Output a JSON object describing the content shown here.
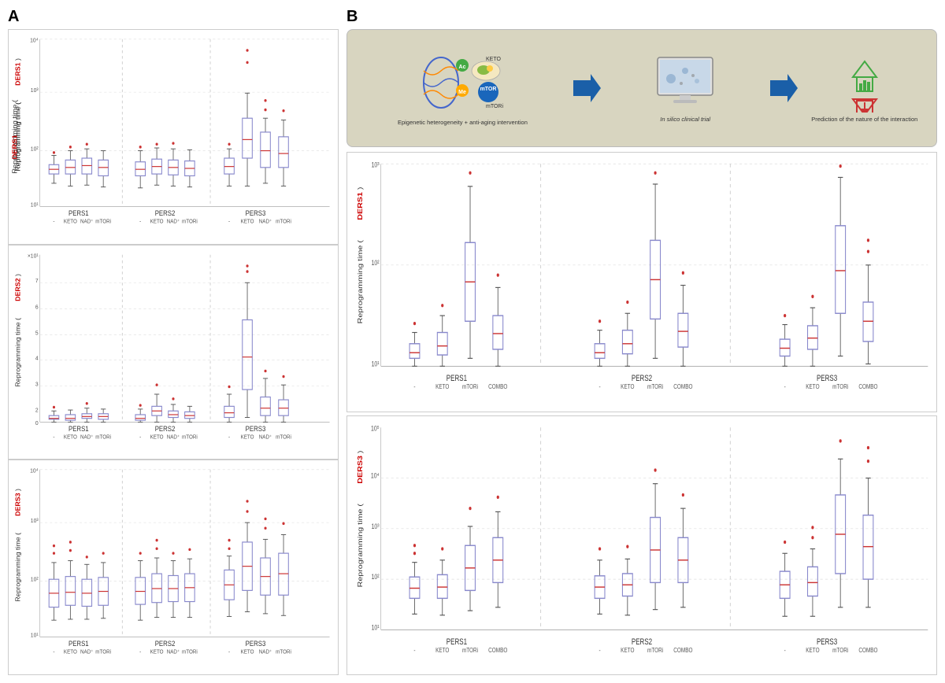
{
  "panelA": {
    "label": "A",
    "charts": [
      {
        "yLabel": "Reprogramming time (DERS1)",
        "yLabelColor": "#cc0000",
        "yScale": "log",
        "groups": [
          "PERS1",
          "PERS2",
          "PERS3"
        ],
        "treatments": [
          "-",
          "KETO",
          "NAD+",
          "mTORi"
        ],
        "title": "DERS1"
      },
      {
        "yLabel": "Reprogramming time (DERS2)",
        "yLabelColor": "#cc0000",
        "yScale": "linear",
        "groups": [
          "PERS1",
          "PERS2",
          "PERS3"
        ],
        "treatments": [
          "-",
          "KETO",
          "NAD+",
          "mTORi"
        ],
        "title": "DERS2"
      },
      {
        "yLabel": "Reprogramming time (DERS3)",
        "yLabelColor": "#cc0000",
        "yScale": "log",
        "groups": [
          "PERS1",
          "PERS2",
          "PERS3"
        ],
        "treatments": [
          "-",
          "KETO",
          "NAD+",
          "mTORi"
        ],
        "title": "DERS3"
      }
    ]
  },
  "panelB": {
    "label": "B",
    "diagramLabels": {
      "left": "Epigenetic heterogeneity + anti-aging intervention",
      "middle": "In silico clinical trial",
      "right": "Prediction of the\nnature of the\ninteraction"
    },
    "charts": [
      {
        "yLabel": "Reprogramming time (DERS1)",
        "yLabelColor": "#cc0000",
        "yScale": "log",
        "groups": [
          "PERS1",
          "PERS2",
          "PERS3"
        ],
        "treatments": [
          "-",
          "KETO",
          "mTORi",
          "COMBO"
        ],
        "title": "DERS1"
      },
      {
        "yLabel": "Reprogramming time (DERS3)",
        "yLabelColor": "#cc0000",
        "yScale": "log",
        "groups": [
          "PERS1",
          "PERS2",
          "PERS3"
        ],
        "treatments": [
          "-",
          "KETO",
          "mTORi",
          "COMBO"
        ],
        "title": "DERS3"
      }
    ]
  }
}
